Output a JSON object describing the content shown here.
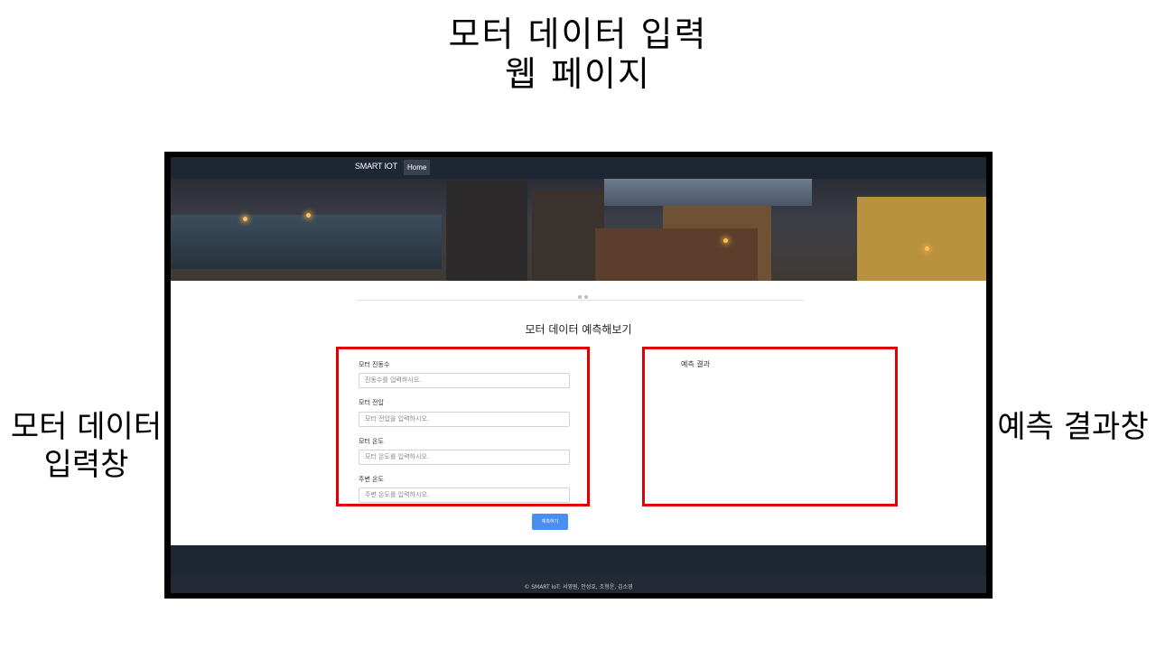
{
  "slide": {
    "title_line1": "모터 데이터 입력",
    "title_line2": "웹 페이지"
  },
  "annotations": {
    "left_label": "모터 데이터\n입력창",
    "right_label": "예측 결과창",
    "box_color": "#e00000"
  },
  "app": {
    "brand": "SMART IOT",
    "nav": {
      "home": "Home"
    },
    "carousel_indicators": 3,
    "section_title": "모터 데이터 예측해보기",
    "form": {
      "fields": [
        {
          "label": "모터 진동수",
          "placeholder": "진동수를 입력하시오."
        },
        {
          "label": "모터 전압",
          "placeholder": "모터 전압을 입력하시오."
        },
        {
          "label": "모터 온도",
          "placeholder": "모터 온도를 입력하시오."
        },
        {
          "label": "주변 온도",
          "placeholder": "주변 온도를 입력하시오."
        }
      ],
      "submit_label": "예측하기"
    },
    "result_title": "예측 결과",
    "footer_text": "© SMART IoT: 서영원, 안성호, 조형운, 김소영",
    "colors": {
      "navbar": "#1f2633",
      "button": "#4a8ef0"
    }
  }
}
